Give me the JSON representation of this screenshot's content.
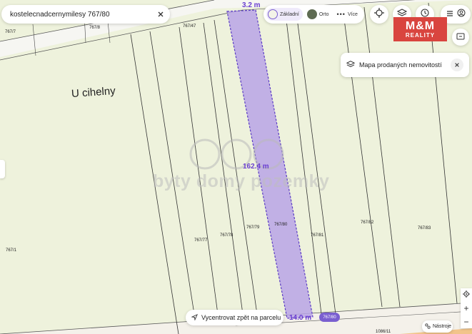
{
  "search": {
    "value": "kostelecnadcernymilesy 767/80"
  },
  "layers": {
    "options": [
      {
        "label": "Základní",
        "active": true
      },
      {
        "label": "Orto",
        "active": false
      },
      {
        "label": "Více",
        "active": false
      }
    ]
  },
  "popup": {
    "label": "Mapa prodaných nemovitostí"
  },
  "map": {
    "locality": "U cihelny",
    "watermark": "byty domy pozemky",
    "parcels": [
      "767/7",
      "767/8",
      "767/47",
      "767/1",
      "767/77",
      "767/78",
      "767/79",
      "767/80",
      "767/81",
      "767/82",
      "767/83",
      "1086/11"
    ],
    "selected_parcel": "767/80"
  },
  "measurements": {
    "top": "3.2 m",
    "length": "162.4 m",
    "bottom": "14.0 m"
  },
  "logo": {
    "line1": "M&M",
    "line2": "REALITY"
  },
  "recenter": {
    "label": "Vycentrovat zpět na parcelu"
  },
  "tools": {
    "label": "Nástroje"
  },
  "zoom": {
    "in": "+",
    "out": "−"
  },
  "colors": {
    "accent": "#7a5fd0",
    "parcel_fill": "#b9a5e6",
    "map_bg": "#eef2dc",
    "logo": "#d9453f"
  },
  "icons": [
    "close-icon",
    "crosshair-icon",
    "layers-icon",
    "history-icon",
    "menu-icon",
    "user-icon",
    "cast-icon",
    "navigation-arrow-icon",
    "locate-icon",
    "tools-icon"
  ]
}
